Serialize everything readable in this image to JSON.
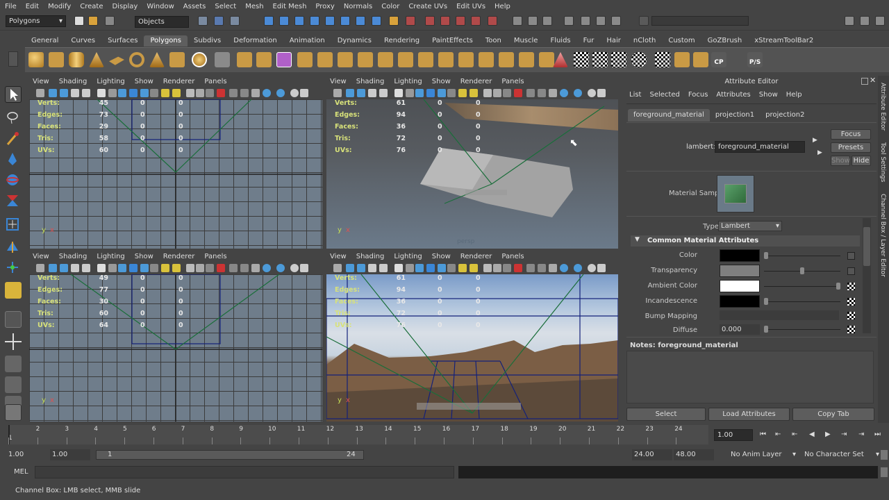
{
  "menubar": [
    "File",
    "Edit",
    "Modify",
    "Create",
    "Display",
    "Window",
    "Assets",
    "Select",
    "Mesh",
    "Edit Mesh",
    "Proxy",
    "Normals",
    "Color",
    "Create UVs",
    "Edit UVs",
    "Help"
  ],
  "status_line": {
    "menuset": "Polygons",
    "selection_field": "Objects"
  },
  "shelf_tabs": [
    "General",
    "Curves",
    "Surfaces",
    "Polygons",
    "Subdivs",
    "Deformation",
    "Animation",
    "Dynamics",
    "Rendering",
    "PaintEffects",
    "Toon",
    "Muscle",
    "Fluids",
    "Fur",
    "Hair",
    "nCloth",
    "Custom",
    "GoZBrush",
    "xStreamToolBar2"
  ],
  "shelf_active": "Polygons",
  "shelf_text": {
    "cp": "CP",
    "ps": "P/S"
  },
  "viewport_menu": [
    "View",
    "Shading",
    "Lighting",
    "Show",
    "Renderer",
    "Panels"
  ],
  "hud_labels": [
    "Verts:",
    "Edges:",
    "Faces:",
    "Tris:",
    "UVs:"
  ],
  "viewports": {
    "top_left": {
      "values": [
        "45",
        "73",
        "29",
        "58",
        "60"
      ],
      "zeros": [
        "0",
        "0"
      ],
      "axis": {
        "a": "y",
        "b": "x"
      }
    },
    "top_right": {
      "values": [
        "61",
        "94",
        "36",
        "72",
        "76"
      ],
      "zeros": [
        "0",
        "0"
      ],
      "axis": {
        "a": "y",
        "b": "x"
      },
      "camera_label": "persp"
    },
    "bottom_left": {
      "values": [
        "49",
        "77",
        "30",
        "60",
        "64"
      ],
      "zeros": [
        "0",
        "0"
      ],
      "axis": {
        "a": "y",
        "b": "x"
      }
    },
    "bottom_right": {
      "values": [
        "61",
        "94",
        "36",
        "72",
        "76"
      ],
      "zeros": [
        "0",
        "0"
      ],
      "axis": {
        "a": "y",
        "b": "x"
      }
    }
  },
  "attribute_editor": {
    "title": "Attribute Editor",
    "menu": [
      "List",
      "Selected",
      "Focus",
      "Attributes",
      "Show",
      "Help"
    ],
    "tabs": [
      "foreground_material",
      "projection1",
      "projection2"
    ],
    "node_type_label": "lambert:",
    "node_name": "foreground_material",
    "buttons": {
      "focus": "Focus",
      "presets": "Presets",
      "show": "Show",
      "hide": "Hide"
    },
    "material_sample_label": "Material Sample",
    "type_label": "Type",
    "type_value": "Lambert",
    "section_title": "Common Material Attributes",
    "attributes": [
      {
        "label": "Color",
        "color": "#000000"
      },
      {
        "label": "Transparency",
        "color": "#7f7f7f"
      },
      {
        "label": "Ambient Color",
        "color": "#ffffff"
      },
      {
        "label": "Incandescence",
        "color": "#000000"
      },
      {
        "label": "Bump Mapping"
      },
      {
        "label": "Diffuse",
        "value": "0.000"
      }
    ],
    "notes_title": "Notes:  foreground_material",
    "bottom_buttons": [
      "Select",
      "Load Attributes",
      "Copy Tab"
    ]
  },
  "side_tabs": [
    "Attribute Editor",
    "Tool Settings",
    "Channel Box / Layer Editor"
  ],
  "time_slider": {
    "ticks": [
      "1",
      "2",
      "3",
      "4",
      "5",
      "6",
      "7",
      "8",
      "9",
      "10",
      "11",
      "12",
      "13",
      "14",
      "15",
      "16",
      "17",
      "18",
      "19",
      "20",
      "21",
      "22",
      "23",
      "24"
    ],
    "current_frame": "1.00"
  },
  "range_slider": {
    "start": "1.00",
    "start2": "1.00",
    "range_start": "1",
    "range_end": "24",
    "end": "24.00",
    "end2": "48.00",
    "anim_layer": "No Anim Layer",
    "character_set": "No Character Set"
  },
  "command_line": {
    "label": "MEL"
  },
  "help_line": "Channel Box: LMB select, MMB slide"
}
